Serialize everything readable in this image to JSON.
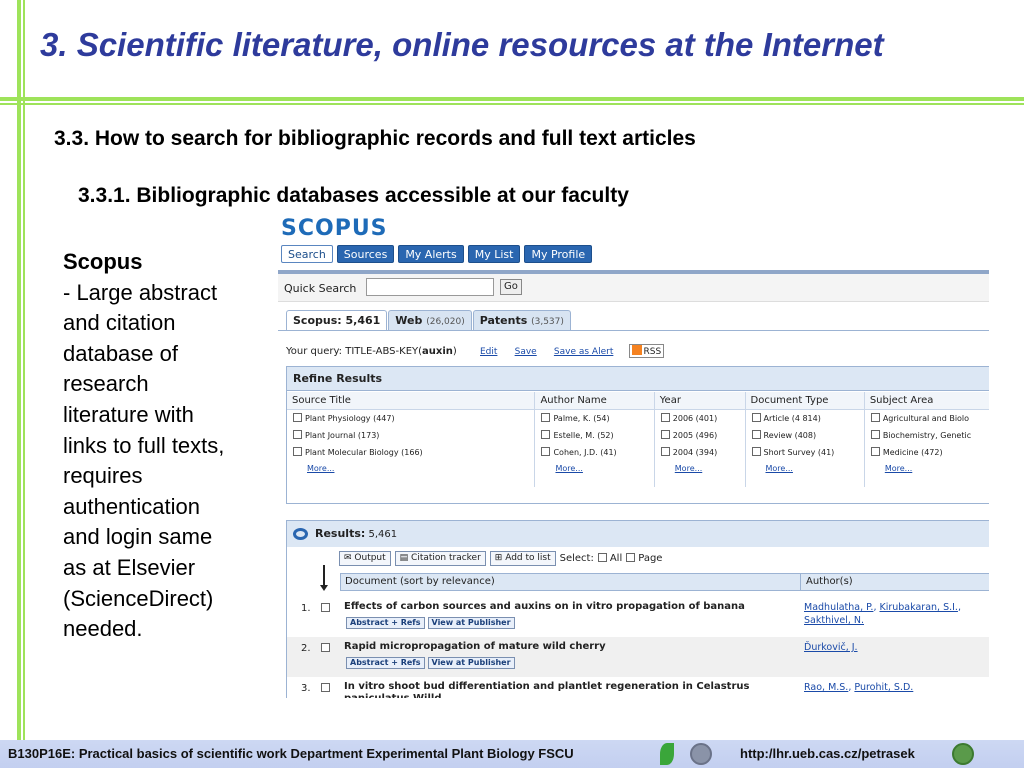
{
  "slide": {
    "title": "3. Scientific literature, online resources at the Internet",
    "heading2": "3.3. How to search for bibliographic records and full text articles",
    "heading3": "3.3.1. Bibliographic databases accessible at our faculty"
  },
  "sidebar": {
    "title": "Scopus",
    "lines": [
      "- Large abstract",
      "and citation",
      "database of",
      "research",
      "literature with",
      "links to full texts,",
      "requires",
      "authentication",
      "and login same",
      "as at Elsevier",
      "(ScienceDirect)",
      "needed."
    ]
  },
  "scopus": {
    "logo": "SCOPUS",
    "nav": [
      "Search",
      "Sources",
      "My Alerts",
      "My List",
      "My Profile"
    ],
    "quick_search_label": "Quick Search",
    "quick_search_value": "",
    "go_label": "Go",
    "tabs": [
      {
        "label": "Scopus: 5,461",
        "count": ""
      },
      {
        "label": "Web",
        "count": "(26,020)"
      },
      {
        "label": "Patents",
        "count": "(3,537)"
      }
    ],
    "query": {
      "prefix": "Your query: TITLE-ABS-KEY(",
      "term": "auxin",
      "suffix": ")",
      "links": [
        "Edit",
        "Save",
        "Save as Alert"
      ],
      "rss": "RSS"
    },
    "refine": {
      "title": "Refine Results",
      "columns": [
        {
          "header": "Source Title",
          "items": [
            "Plant Physiology (447)",
            "Plant Journal (173)",
            "Plant Molecular Biology (166)"
          ],
          "more": "More..."
        },
        {
          "header": "Author Name",
          "items": [
            "Palme, K. (54)",
            "Estelle, M. (52)",
            "Cohen, J.D. (41)"
          ],
          "more": "More..."
        },
        {
          "header": "Year",
          "items": [
            "2006 (401)",
            "2005 (496)",
            "2004 (394)"
          ],
          "more": "More..."
        },
        {
          "header": "Document Type",
          "items": [
            "Article (4 814)",
            "Review (408)",
            "Short Survey (41)"
          ],
          "more": "More..."
        },
        {
          "header": "Subject Area",
          "items": [
            "Agricultural and Biolo",
            "Biochemistry, Genetic",
            "Medicine (472)"
          ],
          "more": "More..."
        }
      ]
    },
    "results": {
      "label": "Results:",
      "count": "5,461",
      "tools": [
        "Output",
        "Citation tracker",
        "Add to list"
      ],
      "select_label": "Select:",
      "select_all": "All",
      "select_page": "Page",
      "col_document": "Document (sort by relevance)",
      "col_authors": "Author(s)",
      "abstract_btn": "Abstract + Refs",
      "publisher_btn": "View at Publisher",
      "rows": [
        {
          "num": "1.",
          "title": "Effects of carbon sources and auxins on in vitro propagation of banana",
          "authors": [
            "Madhulatha, P.",
            "Kirubakaran, S.I.",
            "Sakthivel, N."
          ]
        },
        {
          "num": "2.",
          "title": "Rapid micropropagation of mature wild cherry",
          "authors": [
            "Ďurkovič, J."
          ]
        },
        {
          "num": "3.",
          "title": "In vitro shoot bud differentiation and plantlet regeneration in Celastrus paniculatus Willd",
          "authors": [
            "Rao, M.S.",
            "Purohit, S.D."
          ]
        }
      ]
    }
  },
  "footer": {
    "left": "B130P16E: Practical basics of scientific work   Department  Experimental Plant Biology  FSCU",
    "right": "http:/lhr.ueb.cas.cz/petrasek"
  }
}
